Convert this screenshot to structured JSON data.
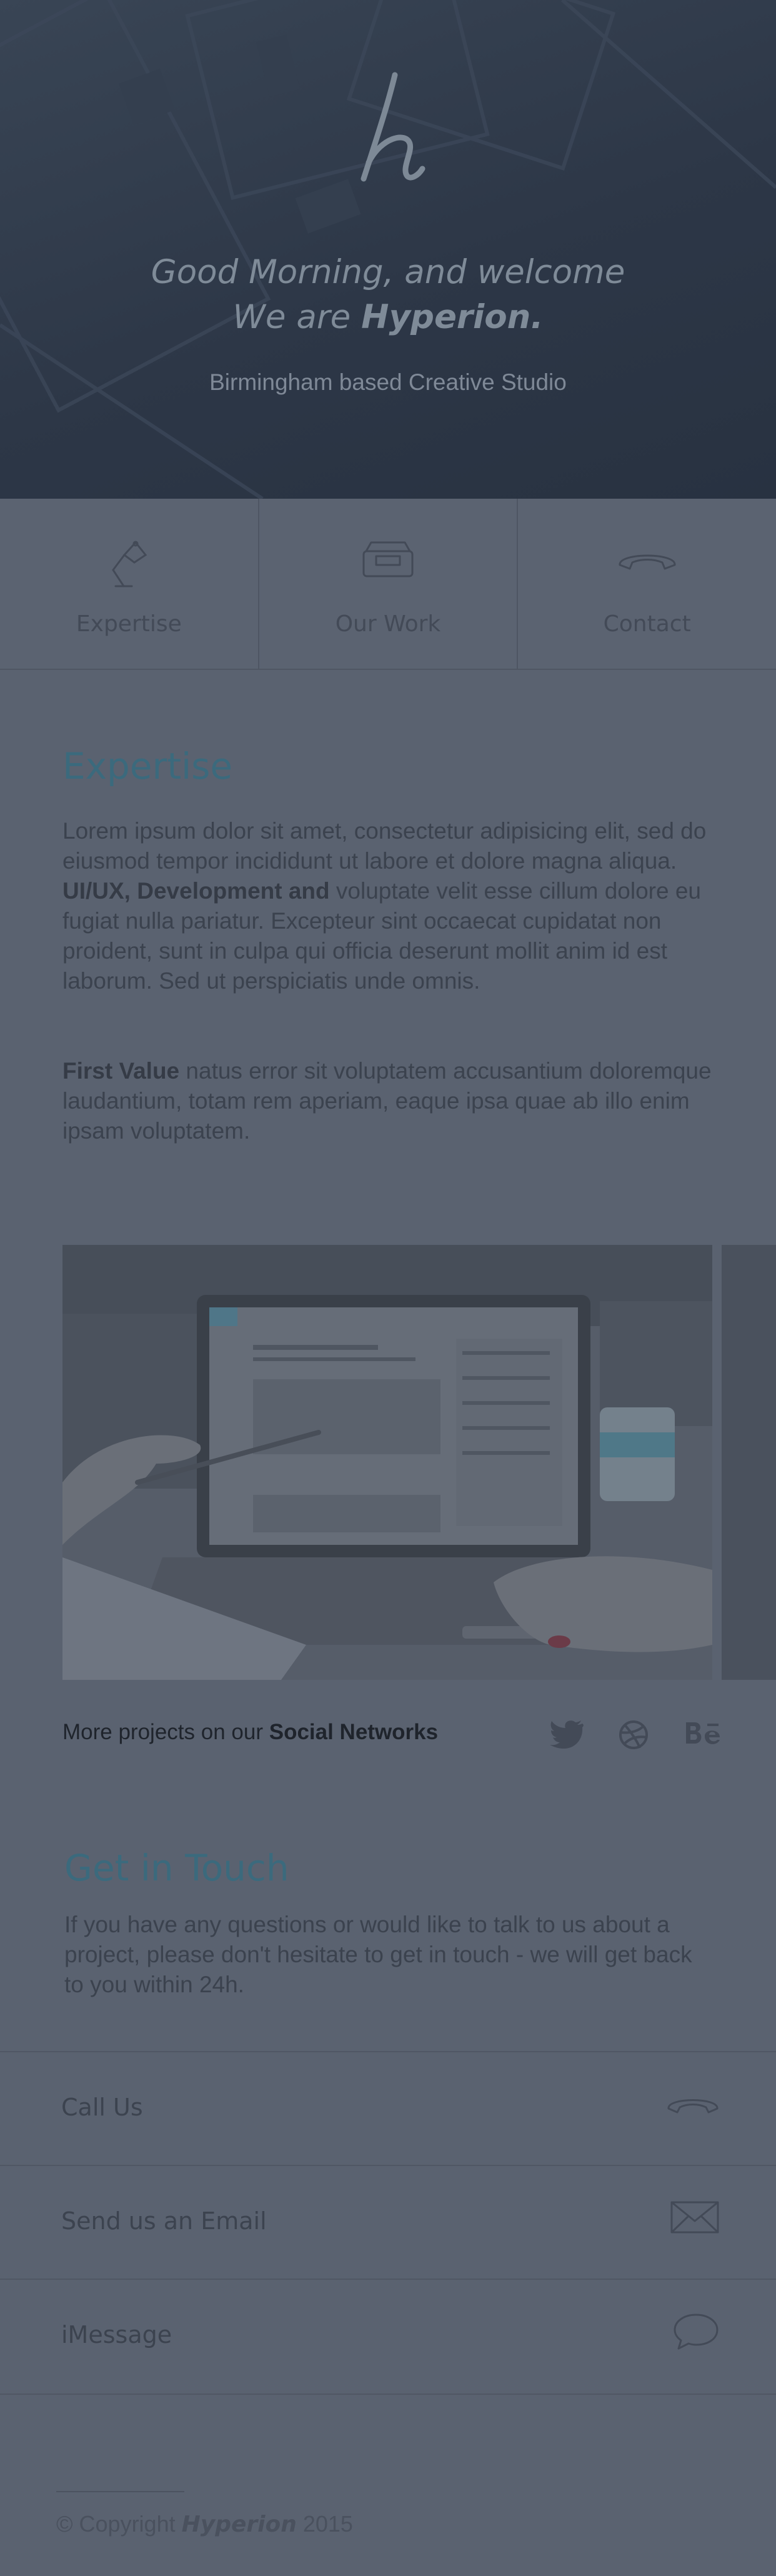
{
  "hero": {
    "title_line1": "Good Morning, and welcome",
    "title_line2_prefix": "We are ",
    "title_line2_brand": "Hyperion.",
    "subtitle": "Birmingham based Creative Studio"
  },
  "nav": [
    {
      "label": "Expertise",
      "icon": "lamp-icon"
    },
    {
      "label": "Our Work",
      "icon": "inbox-tray-icon"
    },
    {
      "label": "Contact",
      "icon": "phone-icon"
    }
  ],
  "expertise": {
    "title": "Expertise",
    "p1_a": "Lorem ipsum dolor sit amet, consectetur adipisicing elit, sed do eiusmod tempor incididunt ut labore et dolore magna aliqua. ",
    "p1_bold": "UI/UX, Development and",
    "p1_b": " voluptate velit esse cillum dolore eu fugiat nulla pariatur. Excepteur sint occaecat cupidatat non proident, sunt in culpa qui officia deserunt mollit anim id est laborum. Sed ut perspiciatis unde omnis.",
    "p2_bold": "First Value",
    "p2_a": " natus error sit voluptatem accusantium doloremque laudantium, totam rem aperiam, eaque ipsa quae ab illo enim ipsam voluptatem."
  },
  "social": {
    "prefix": "More projects on our ",
    "bold": "Social Networks",
    "icons": [
      "twitter-icon",
      "dribbble-icon",
      "behance-icon"
    ]
  },
  "contact": {
    "title": "Get in Touch",
    "text": "If you have any questions or would like to talk to us about a project, please don't hesitate to get in touch - we will get back to you within 24h.",
    "rows": [
      {
        "label": "Call Us",
        "icon": "phone-icon"
      },
      {
        "label": "Send us an Email",
        "icon": "envelope-icon"
      },
      {
        "label": "iMessage",
        "icon": "chat-bubble-icon"
      }
    ]
  },
  "footer": {
    "prefix": "© Copyright ",
    "brand": "Hyperion",
    "year": " 2015"
  },
  "colors": {
    "overlay": "#5a6270",
    "hero": "#2d3747",
    "accent": "#3b6a7d"
  }
}
